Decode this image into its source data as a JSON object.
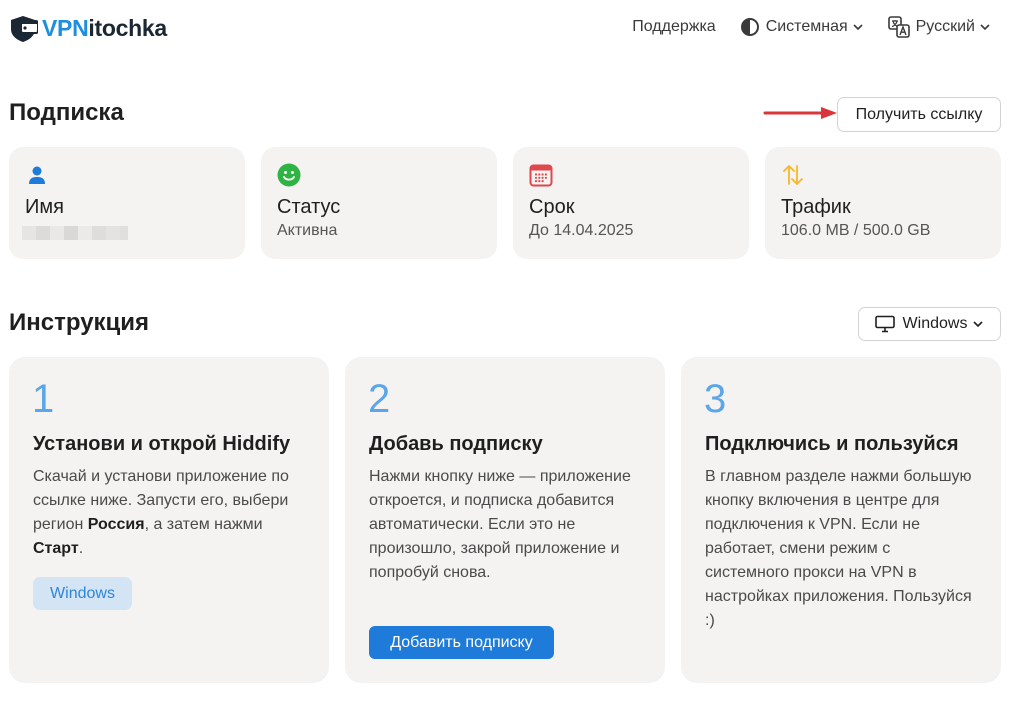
{
  "header": {
    "logo": {
      "part1": "VPN",
      "part2": "itochka"
    },
    "nav": {
      "support": "Поддержка",
      "theme": "Системная",
      "language": "Русский"
    }
  },
  "subscription": {
    "title": "Подписка",
    "get_link_label": "Получить ссылку",
    "cards": {
      "name": {
        "title": "Имя",
        "value": ""
      },
      "status": {
        "title": "Статус",
        "value": "Активна"
      },
      "term": {
        "title": "Срок",
        "value": "До 14.04.2025"
      },
      "traffic": {
        "title": "Трафик",
        "value": "106.0 MB / 500.0 GB"
      }
    }
  },
  "instructions": {
    "title": "Инструкция",
    "platform_select": "Windows",
    "steps": [
      {
        "number": "1",
        "title": "Установи и открой Hiddify",
        "text_before": "Скачай и установи приложение по ссылке ниже. Запусти его, выбери регион ",
        "bold1": "Россия",
        "text_middle": ", а затем нажми ",
        "bold2": "Старт",
        "text_after": ".",
        "button": "Windows"
      },
      {
        "number": "2",
        "title": "Добавь подписку",
        "text": "Нажми кнопку ниже — приложение откроется, и подписка добавится автоматически. Если это не произошло, закрой приложение и попробуй снова.",
        "button": "Добавить подписку"
      },
      {
        "number": "3",
        "title": "Подключись и пользуйся",
        "text": "В главном разделе нажми большую кнопку включения в центре для подключения к VPN. Если не работает, смени режим с системного прокси на VPN в настройках приложения. Пользуйся :)"
      }
    ]
  },
  "colors": {
    "accent": "#1e7bd9",
    "brand": "#1e8fe0",
    "status_ok": "#2fb344",
    "calendar": "#e0474c",
    "traffic": "#f5b72b",
    "annotation_arrow": "#d8363a"
  }
}
